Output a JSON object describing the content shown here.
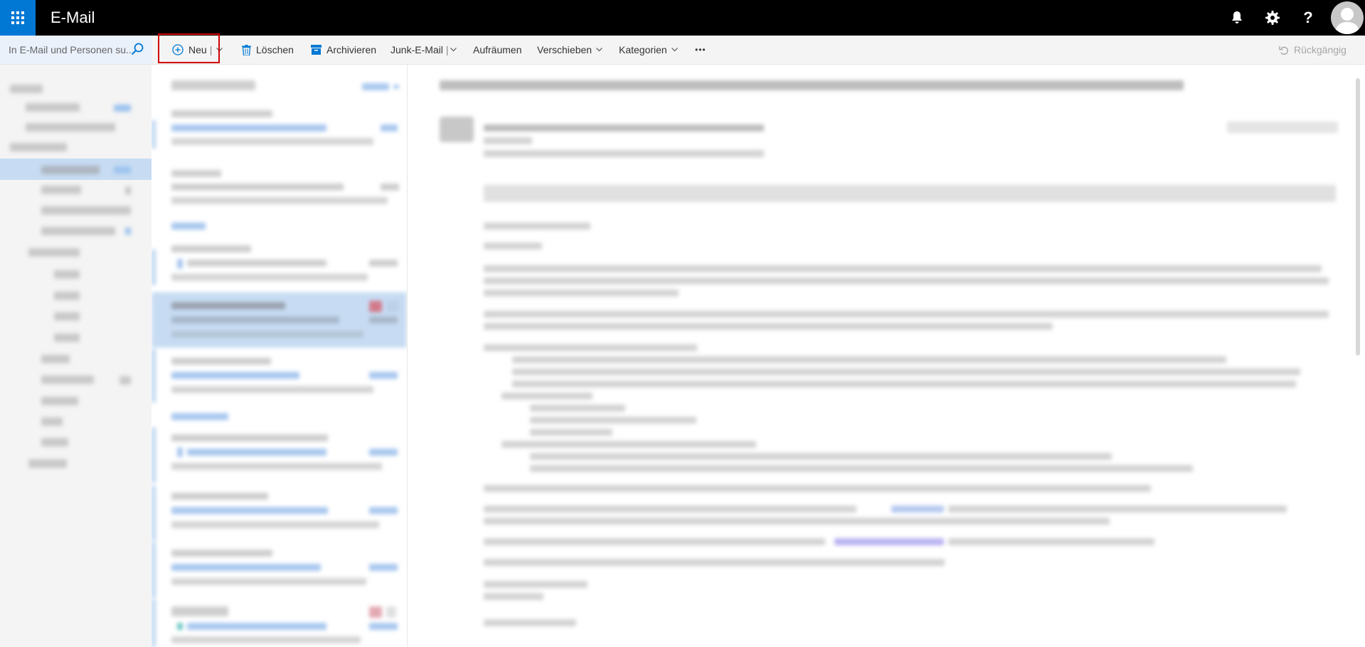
{
  "app": {
    "title": "E-Mail"
  },
  "topbar": {
    "icons": [
      "app-launcher-icon",
      "bell-icon",
      "gear-icon",
      "help-icon",
      "avatar"
    ],
    "help_glyph": "?"
  },
  "search": {
    "placeholder": "In E-Mail und Personen su..."
  },
  "toolbar": {
    "new_label": "Neu",
    "delete_label": "Löschen",
    "archive_label": "Archivieren",
    "junk_label": "Junk-E-Mail",
    "cleanup_label": "Aufräumen",
    "move_label": "Verschieben",
    "categories_label": "Kategorien",
    "more_label": "•••",
    "undo_label": "Rückgängig"
  },
  "colors": {
    "brand": "#0078d4",
    "topbar": "#000000",
    "highlight_box": "#d00000",
    "selected": "#c7dcf3"
  }
}
